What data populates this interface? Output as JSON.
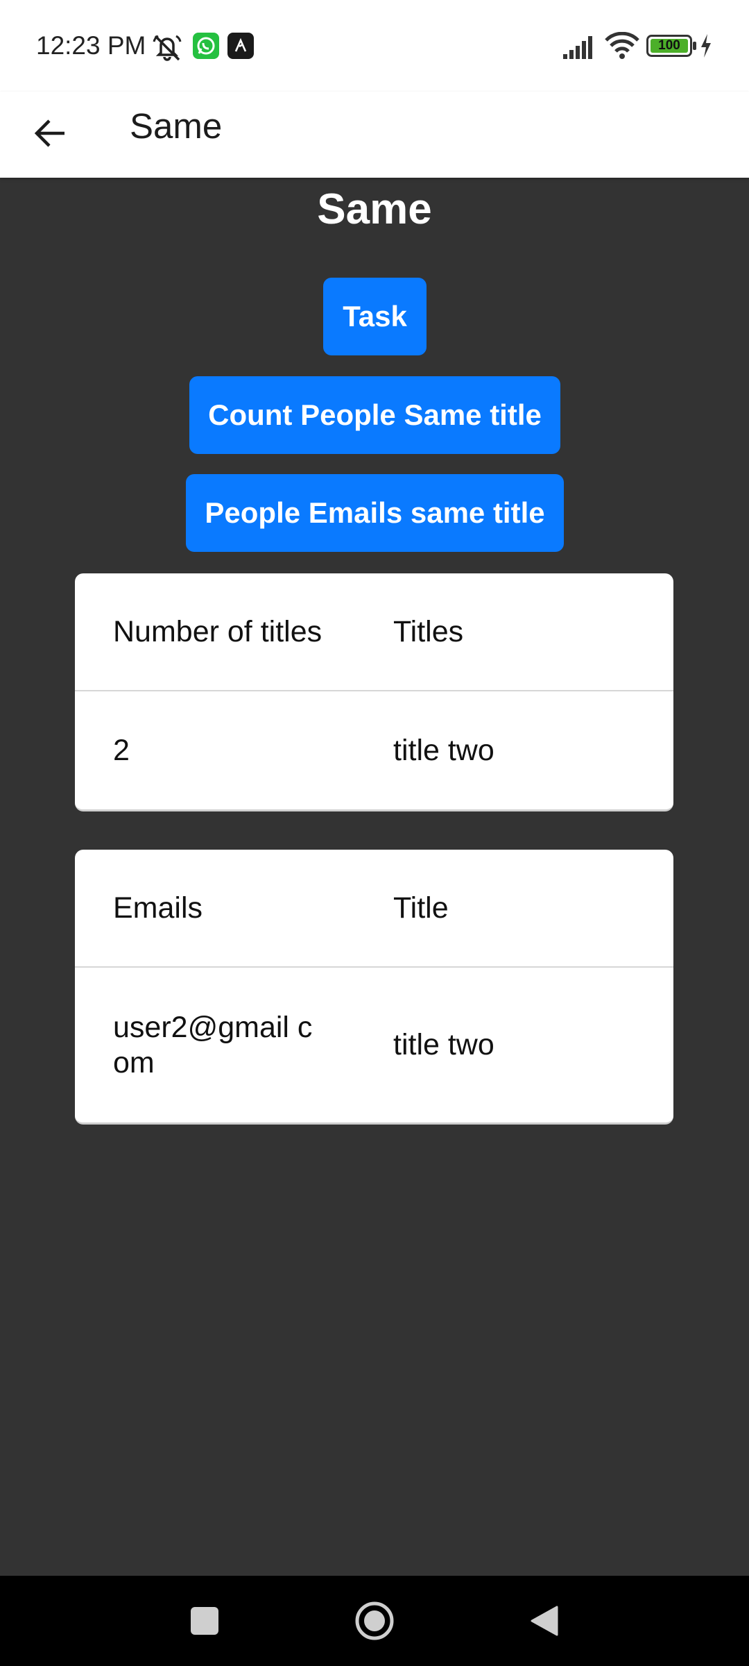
{
  "status_bar": {
    "time": "12:23 PM",
    "battery": "100",
    "icons": [
      "muted-bell-icon",
      "whatsapp-icon",
      "app-icon",
      "signal-icon",
      "wifi-icon",
      "battery-icon",
      "charging-icon"
    ]
  },
  "app_bar": {
    "title": "Same",
    "back_icon": "arrow-back-icon"
  },
  "page": {
    "heading": "Same",
    "buttons": {
      "task": "Task",
      "count_people": "Count People Same title",
      "people_emails": "People Emails same title"
    }
  },
  "tables": [
    {
      "headers": [
        "Number of titles",
        "Titles"
      ],
      "rows": [
        [
          "2",
          "title two"
        ]
      ]
    },
    {
      "headers": [
        "Emails",
        "Title"
      ],
      "rows": [
        [
          "user2@gmail com",
          "title two"
        ]
      ]
    }
  ],
  "nav_bar": {
    "icons": [
      "recents-square-icon",
      "home-circle-icon",
      "back-triangle-icon"
    ]
  },
  "colors": {
    "background": "#333333",
    "button": "#0a7aff",
    "card": "#ffffff",
    "app_bar": "#ffffff"
  }
}
